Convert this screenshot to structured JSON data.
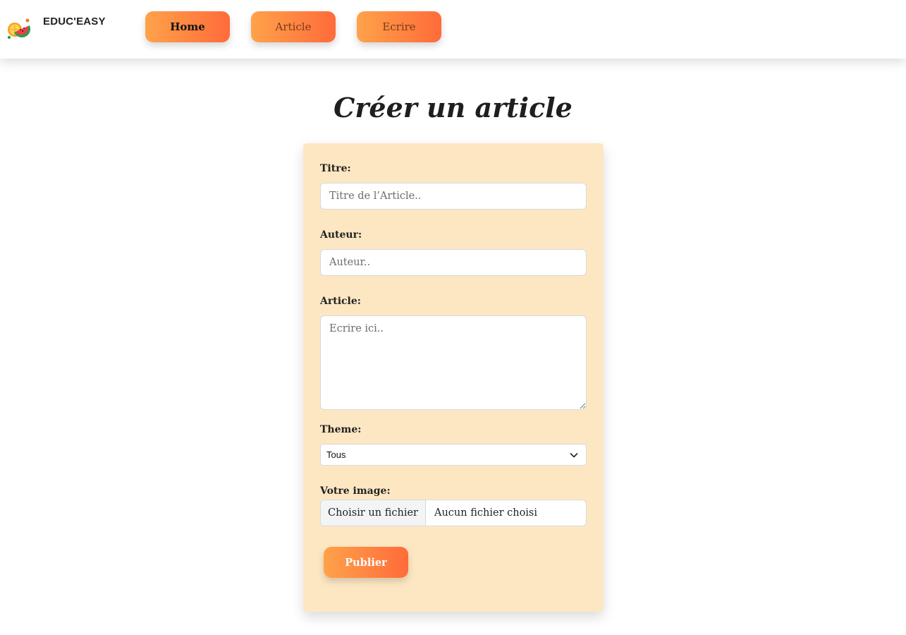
{
  "brand": {
    "name": "EDUC'EASY",
    "logo_icon": "watermelon-orange-logo-icon"
  },
  "nav": {
    "items": [
      {
        "label": "Home"
      },
      {
        "label": "Article"
      },
      {
        "label": "Ecrire"
      }
    ]
  },
  "page": {
    "title": "Créer un article"
  },
  "form": {
    "title_label": "Titre:",
    "title_placeholder": "Titre de l’Article..",
    "author_label": "Auteur:",
    "author_placeholder": "Auteur..",
    "article_label": "Article:",
    "article_placeholder": "Ecrire ici..",
    "theme_label": "Theme:",
    "theme_selected": "Tous",
    "image_label": "Votre image:",
    "file_button": "Choisir un fichier",
    "file_status": "Aucun fichier choisi",
    "submit_label": "Publier"
  },
  "colors": {
    "accent_start": "#ffa24a",
    "accent_end": "#ff6b3a",
    "card_bg": "#fde7c3"
  }
}
